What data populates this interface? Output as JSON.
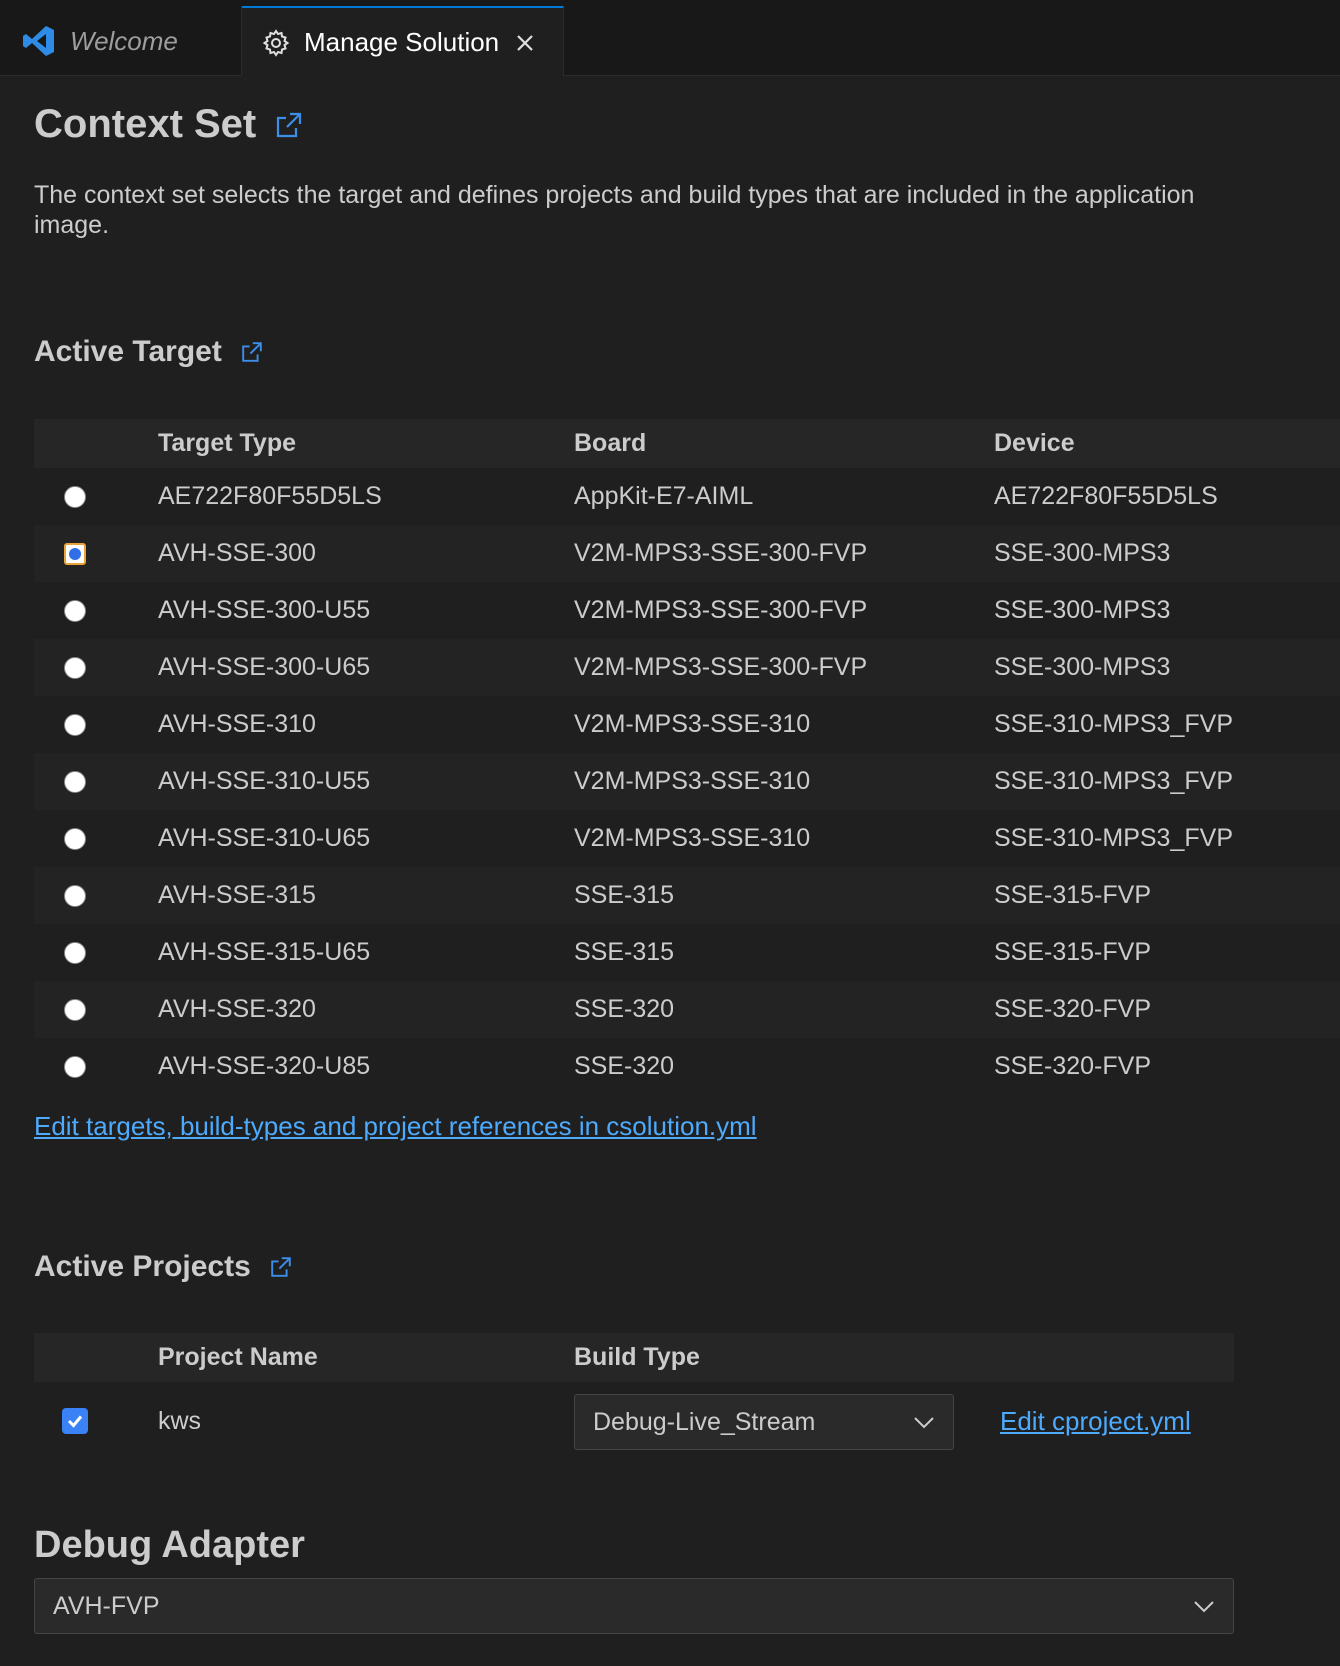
{
  "tabs": [
    {
      "label": "Welcome",
      "icon": "vscode-logo-icon"
    },
    {
      "label": "Manage Solution",
      "icon": "gear-icon",
      "active": true
    }
  ],
  "context_set": {
    "title": "Context Set",
    "description": "The context set selects the target and defines projects and build types that are included in the application image."
  },
  "active_target": {
    "title": "Active Target",
    "columns": [
      "Target Type",
      "Board",
      "Device"
    ],
    "rows": [
      {
        "target": "AE722F80F55D5LS",
        "board": "AppKit-E7-AIML",
        "device": "AE722F80F55D5LS",
        "selected": false
      },
      {
        "target": "AVH-SSE-300",
        "board": "V2M-MPS3-SSE-300-FVP",
        "device": "SSE-300-MPS3",
        "selected": true
      },
      {
        "target": "AVH-SSE-300-U55",
        "board": "V2M-MPS3-SSE-300-FVP",
        "device": "SSE-300-MPS3",
        "selected": false
      },
      {
        "target": "AVH-SSE-300-U65",
        "board": "V2M-MPS3-SSE-300-FVP",
        "device": "SSE-300-MPS3",
        "selected": false
      },
      {
        "target": "AVH-SSE-310",
        "board": "V2M-MPS3-SSE-310",
        "device": "SSE-310-MPS3_FVP",
        "selected": false
      },
      {
        "target": "AVH-SSE-310-U55",
        "board": "V2M-MPS3-SSE-310",
        "device": "SSE-310-MPS3_FVP",
        "selected": false
      },
      {
        "target": "AVH-SSE-310-U65",
        "board": "V2M-MPS3-SSE-310",
        "device": "SSE-310-MPS3_FVP",
        "selected": false
      },
      {
        "target": "AVH-SSE-315",
        "board": "SSE-315",
        "device": "SSE-315-FVP",
        "selected": false
      },
      {
        "target": "AVH-SSE-315-U65",
        "board": "SSE-315",
        "device": "SSE-315-FVP",
        "selected": false
      },
      {
        "target": "AVH-SSE-320",
        "board": "SSE-320",
        "device": "SSE-320-FVP",
        "selected": false
      },
      {
        "target": "AVH-SSE-320-U85",
        "board": "SSE-320",
        "device": "SSE-320-FVP",
        "selected": false
      }
    ],
    "edit_link": "Edit targets, build-types and project references in csolution.yml"
  },
  "active_projects": {
    "title": "Active Projects",
    "columns": [
      "Project Name",
      "Build Type"
    ],
    "rows": [
      {
        "name": "kws",
        "checked": true,
        "build_type": "Debug-Live_Stream",
        "edit_link": "Edit cproject.yml"
      }
    ]
  },
  "debug_adapter": {
    "title": "Debug Adapter",
    "value": "AVH-FVP"
  },
  "colors": {
    "background": "#1f1f1f",
    "link": "#4daafc",
    "accent": "#3b82f6"
  }
}
